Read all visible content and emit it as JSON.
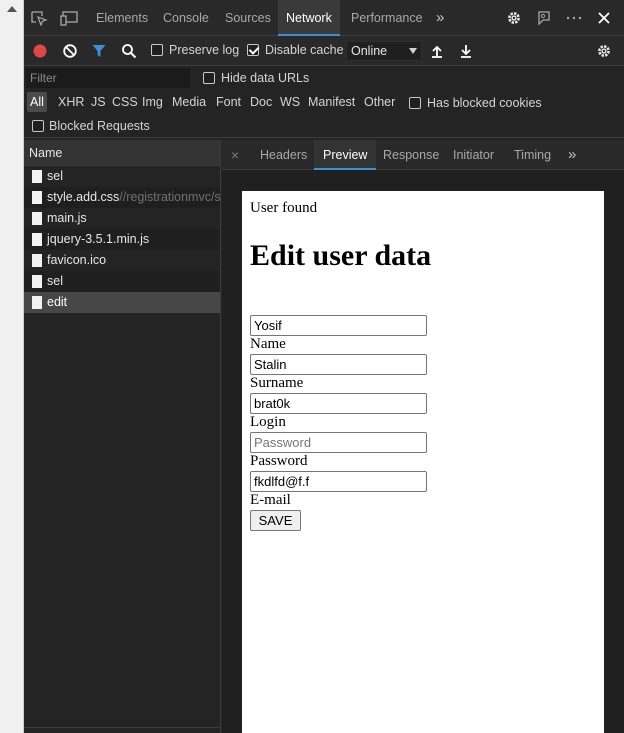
{
  "tabs": {
    "items": [
      "Elements",
      "Console",
      "Sources",
      "Network",
      "Performance"
    ],
    "active": "Network",
    "more_glyph": "»",
    "icons": [
      "inspect-element-icon",
      "device-emulation-icon",
      "gear-icon",
      "feedback-icon",
      "more-options-icon",
      "close-icon"
    ]
  },
  "toolbar": {
    "preserve_log": {
      "label": "Preserve log",
      "checked": false
    },
    "disable_cache": {
      "label": "Disable cache",
      "checked": true
    },
    "throttling": "Online",
    "icons": [
      "record-icon",
      "clear-icon",
      "filter-icon",
      "search-icon",
      "import-icon",
      "export-icon",
      "gear-icon"
    ]
  },
  "filter": {
    "placeholder": "Filter",
    "hide_data_urls": {
      "label": "Hide data URLs",
      "checked": false
    }
  },
  "types": {
    "items": [
      "All",
      "XHR",
      "JS",
      "CSS",
      "Img",
      "Media",
      "Font",
      "Doc",
      "WS",
      "Manifest",
      "Other"
    ],
    "active": "All",
    "has_blocked_cookies": {
      "label": "Has blocked cookies",
      "checked": false
    },
    "blocked_requests": {
      "label": "Blocked Requests",
      "checked": false
    }
  },
  "requests": {
    "header": "Name",
    "rows": [
      {
        "name": "sel",
        "url": ""
      },
      {
        "name": "style.add.css",
        "url": "//registrationmvc/sel"
      },
      {
        "name": "main.js",
        "url": ""
      },
      {
        "name": "jquery-3.5.1.min.js",
        "url": ""
      },
      {
        "name": "favicon.ico",
        "url": ""
      },
      {
        "name": "sel",
        "url": ""
      },
      {
        "name": "edit",
        "url": ""
      }
    ],
    "selected": "edit"
  },
  "detail": {
    "close_glyph": "×",
    "tabs": [
      "Headers",
      "Preview",
      "Response",
      "Initiator",
      "Timing"
    ],
    "active": "Preview",
    "more_glyph": "»"
  },
  "preview": {
    "status": "User found",
    "heading": "Edit user data",
    "fields": [
      {
        "value": "Yosif",
        "placeholder": "",
        "label": "Name"
      },
      {
        "value": "Stalin",
        "placeholder": "",
        "label": "Surname"
      },
      {
        "value": "brat0k",
        "placeholder": "",
        "label": "Login"
      },
      {
        "value": "",
        "placeholder": "Password",
        "label": "Password"
      },
      {
        "value": "fkdlfd@f.f",
        "placeholder": "",
        "label": "E-mail"
      }
    ],
    "save_label": "SAVE"
  },
  "colors": {
    "accent": "#3a8fd8",
    "record": "#e04848",
    "filter_icon": "#3a8fd8",
    "panel_bg": "#242424",
    "selected_row": "#474747"
  }
}
